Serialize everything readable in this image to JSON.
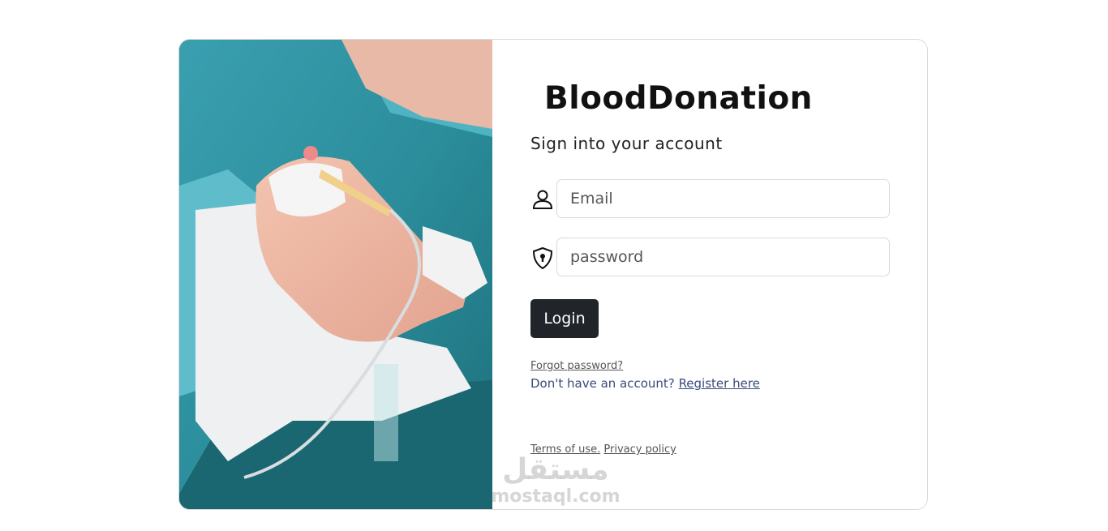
{
  "brand": {
    "name": "BloodDonation"
  },
  "form": {
    "subtitle": "Sign into your account",
    "email_placeholder": "Email",
    "password_placeholder": "password",
    "login_label": "Login",
    "forgot_label": "Forgot password?",
    "register_prompt": "Don't have an account?",
    "register_link": "Register here",
    "terms_label": "Terms of use.",
    "privacy_label": "Privacy policy"
  },
  "icons": {
    "email": "person-icon",
    "password": "shield-lock-icon"
  },
  "watermark": {
    "arabic": "مستقل",
    "latin": "mostaql.com"
  },
  "colors": {
    "login_bg": "#212529",
    "link": "#3a4a7a"
  }
}
